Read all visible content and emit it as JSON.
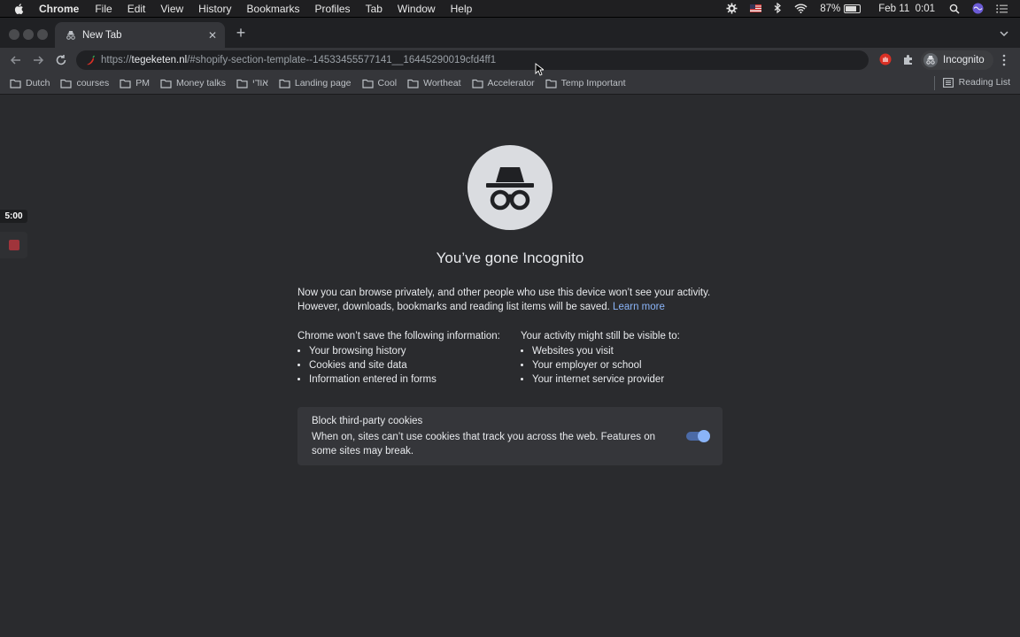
{
  "menubar": {
    "app": "Chrome",
    "items": [
      "File",
      "Edit",
      "View",
      "History",
      "Bookmarks",
      "Profiles",
      "Tab",
      "Window",
      "Help"
    ],
    "battery": "87%",
    "datetime": "Feb 11  0:01"
  },
  "tab": {
    "title": "New Tab"
  },
  "omnibox": {
    "scheme": "https://",
    "host": "tegeketen.nl",
    "path": "/#shopify-section-template--14533455577141__16445290019cfd4ff1"
  },
  "profile": {
    "label": "Incognito"
  },
  "bookmarks": [
    "Dutch",
    "courses",
    "PM",
    "Money talks",
    "אודי",
    "Landing page",
    "Cool",
    "Wortheat",
    "Accelerator",
    "Temp Important"
  ],
  "reading_list": "Reading List",
  "page": {
    "headline": "You’ve gone Incognito",
    "intro": "Now you can browse privately, and other people who use this device won’t see your activity. However, downloads, bookmarks and reading list items will be saved.",
    "learn_more": "Learn more",
    "left_heading_pre": "Chrome ",
    "left_heading_bold": "won’t save",
    "left_heading_post": " the following information:",
    "left_items": [
      "Your browsing history",
      "Cookies and site data",
      "Information entered in forms"
    ],
    "right_heading_pre": "Your activity ",
    "right_heading_bold": "might still be visible",
    "right_heading_post": " to:",
    "right_items": [
      "Websites you visit",
      "Your employer or school",
      "Your internet service provider"
    ],
    "cookie_title": "Block third-party cookies",
    "cookie_desc": "When on, sites can’t use cookies that track you across the web. Features on some sites may break.",
    "cookie_toggle_on": true
  },
  "recorder": {
    "timer": "5:00"
  },
  "colors": {
    "accent": "#8ab4f8",
    "background": "#202124",
    "surface": "#35363a"
  }
}
